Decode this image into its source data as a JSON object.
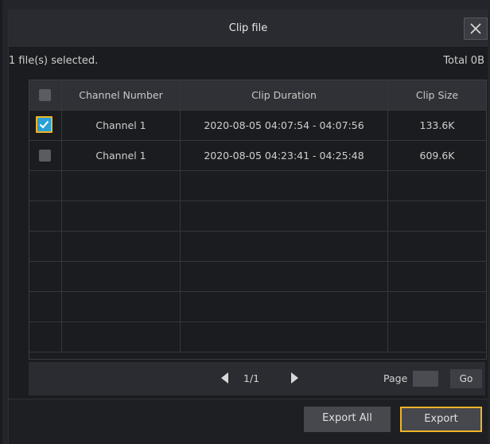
{
  "dialog": {
    "title": "Clip file",
    "selected_text": "1 file(s) selected.",
    "total_text": "Total 0B"
  },
  "table": {
    "columns": [
      "",
      "Channel Number",
      "Clip Duration",
      "Clip Size"
    ],
    "rows": [
      {
        "checked": true,
        "channel": "Channel 1",
        "duration": "2020-08-05 04:07:54 - 04:07:56",
        "size": "133.6K"
      },
      {
        "checked": false,
        "channel": "Channel 1",
        "duration": "2020-08-05 04:23:41 - 04:25:48",
        "size": "609.6K"
      }
    ]
  },
  "pager": {
    "page_info": "1/1",
    "page_label": "Page",
    "page_input_value": "",
    "go_label": "Go"
  },
  "footer": {
    "export_all_label": "Export All",
    "export_label": "Export"
  },
  "colors": {
    "accent": "#f0b429",
    "check_fill": "#2aa0d6"
  },
  "icons": {
    "close": "close-icon",
    "prev": "triangle-left-icon",
    "next": "triangle-right-icon",
    "check": "checkmark-icon"
  }
}
